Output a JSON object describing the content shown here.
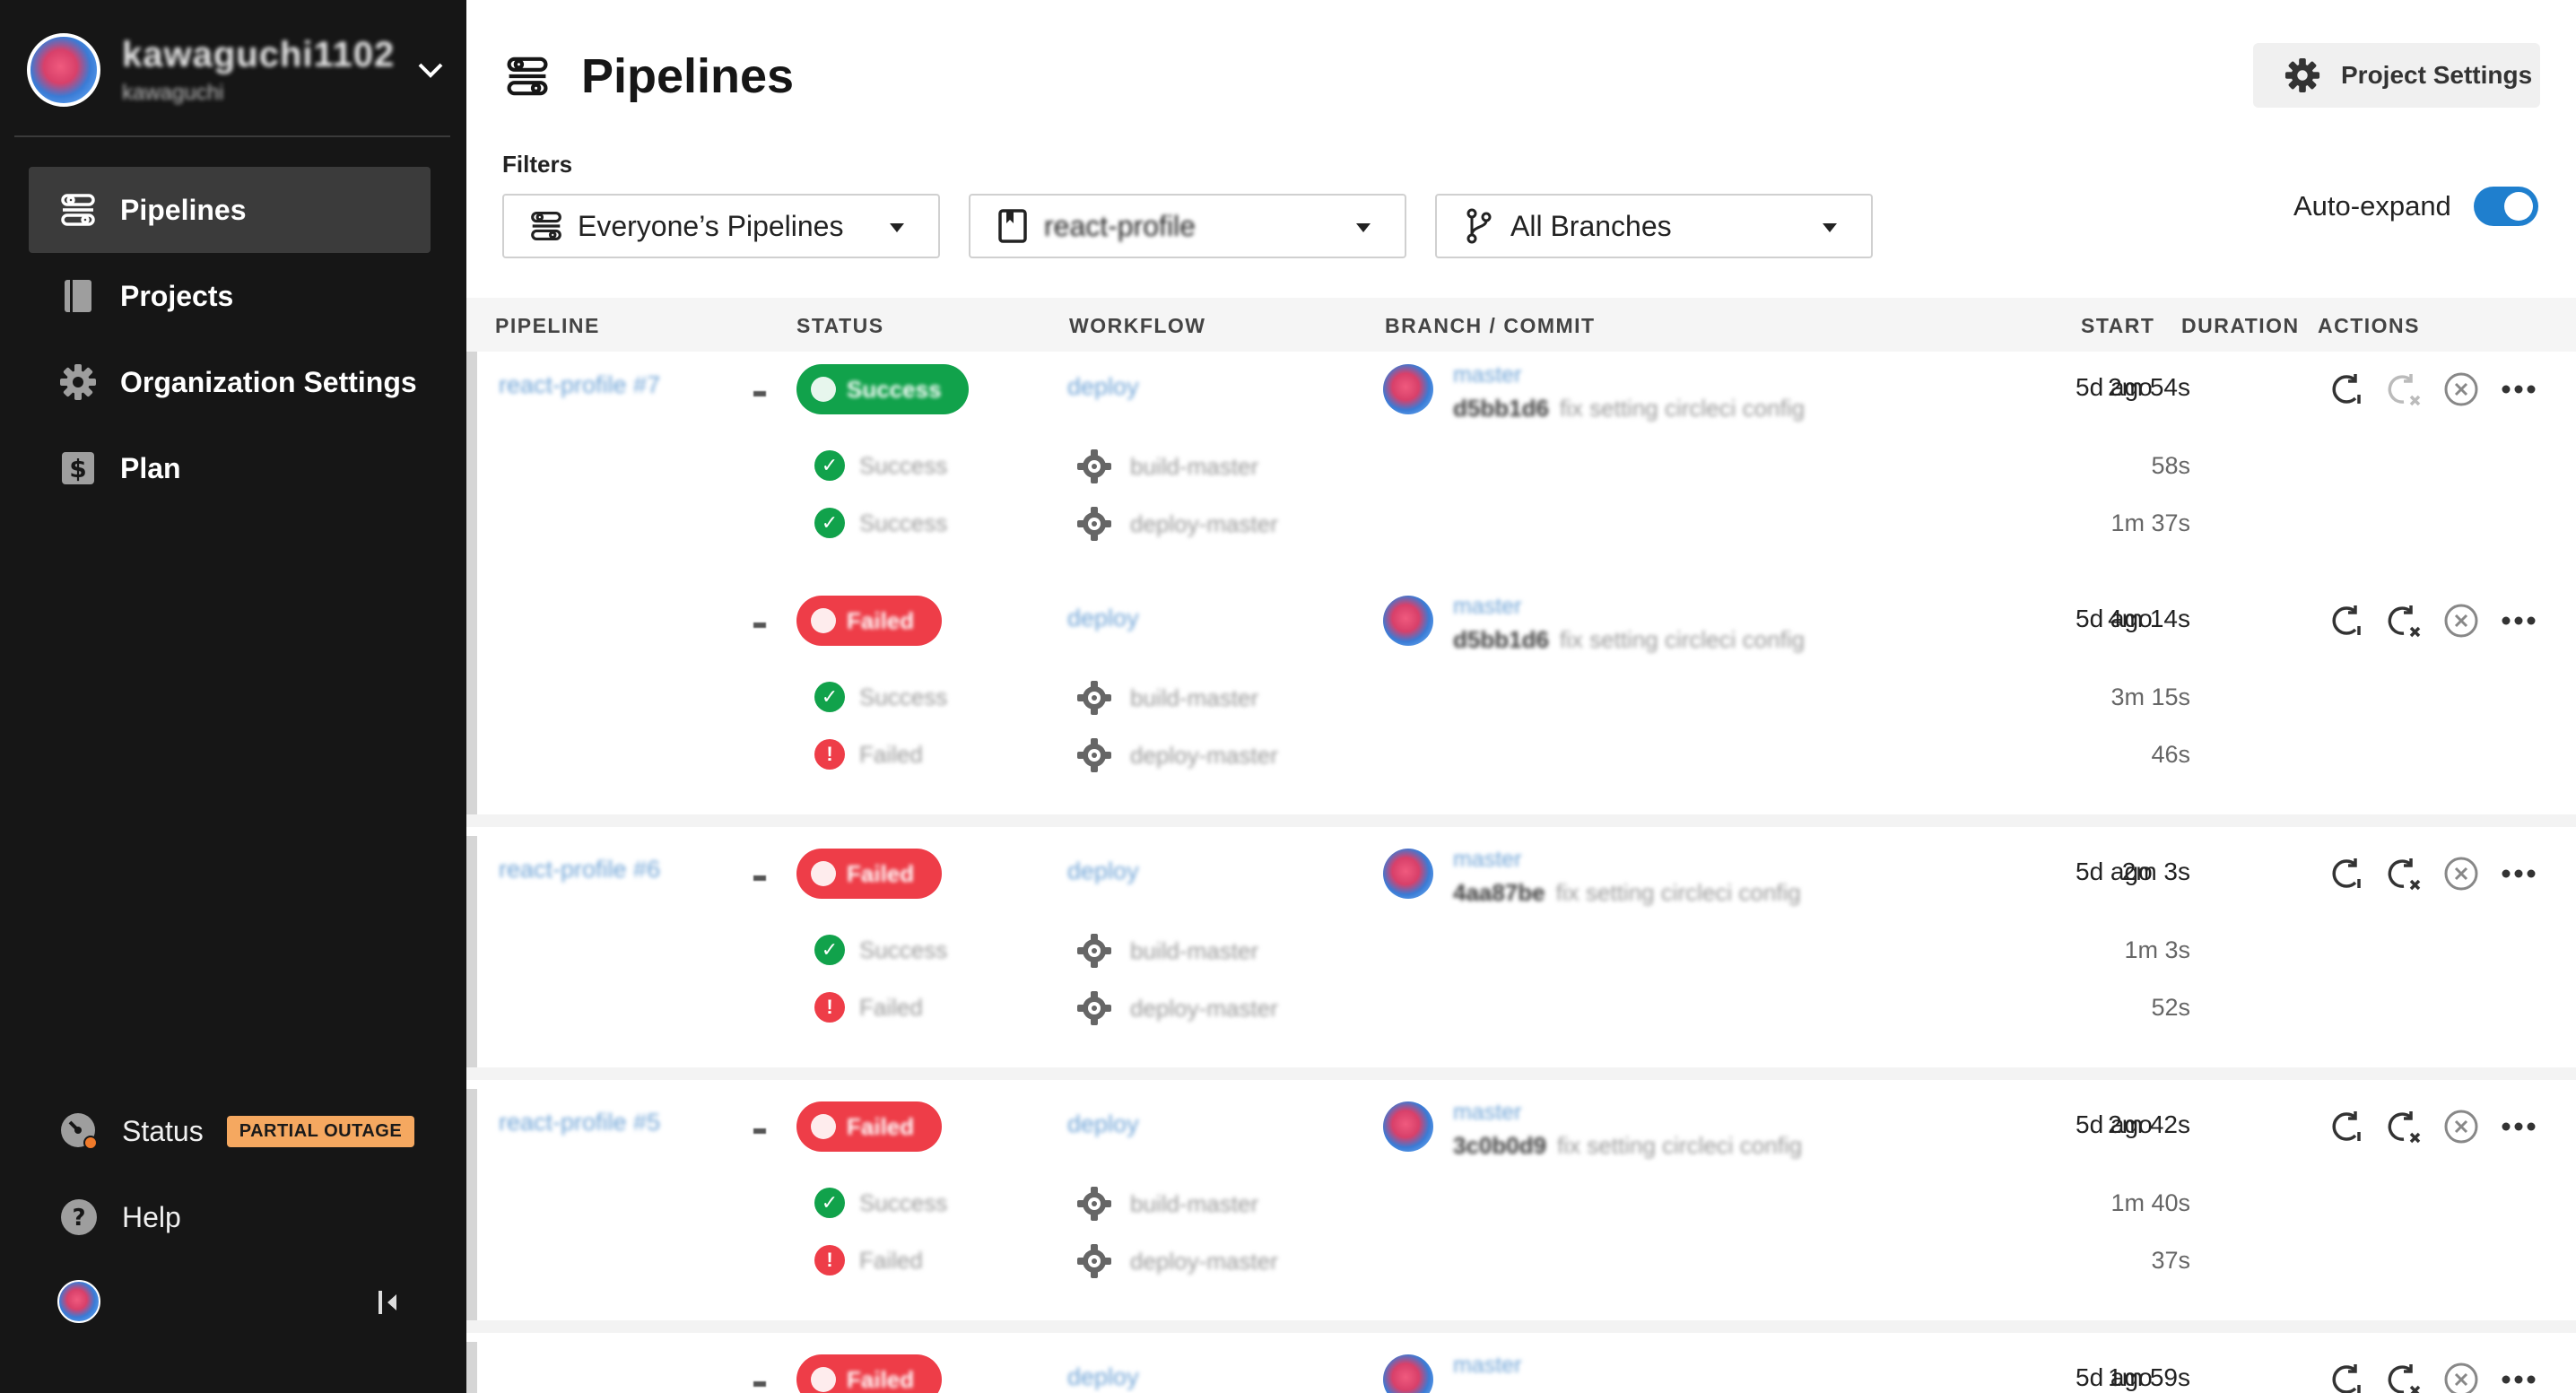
{
  "sidebar": {
    "user": {
      "name": "kawaguchi1102",
      "org": "kawaguchi"
    },
    "nav": [
      {
        "label": "Pipelines",
        "icon": "pipelines-icon",
        "active": true
      },
      {
        "label": "Projects",
        "icon": "book-icon",
        "active": false
      },
      {
        "label": "Organization Settings",
        "icon": "gear-icon",
        "active": false
      },
      {
        "label": "Plan",
        "icon": "dollar-icon",
        "active": false
      }
    ],
    "status": {
      "label": "Status",
      "badge": "PARTIAL OUTAGE"
    },
    "help": {
      "label": "Help"
    }
  },
  "header": {
    "title": "Pipelines",
    "project_settings_label": "Project Settings"
  },
  "filters": {
    "label": "Filters",
    "pipelines_value": "Everyone’s Pipelines",
    "project_value": "react-profile",
    "branches_value": "All Branches",
    "auto_expand_label": "Auto-expand",
    "auto_expand_on": true
  },
  "table": {
    "headers": {
      "pipeline": "PIPELINE",
      "status": "STATUS",
      "workflow": "WORKFLOW",
      "branch_commit": "BRANCH / COMMIT",
      "start": "START",
      "duration": "DURATION",
      "actions": "ACTIONS"
    },
    "groups": [
      {
        "pipeline": "react-profile #7",
        "workflows": [
          {
            "status": "Success",
            "status_type": "success",
            "workflow": "deploy",
            "branch": "master",
            "commit_hash": "d5bb1d6",
            "commit_msg": "fix setting circleci config",
            "start": "5d ago",
            "duration": "2m 54s",
            "jobs": [
              {
                "status": "Success",
                "status_type": "success",
                "name": "build-master",
                "duration": "58s"
              },
              {
                "status": "Success",
                "status_type": "success",
                "name": "deploy-master",
                "duration": "1m 37s"
              }
            ]
          },
          {
            "status": "Failed",
            "status_type": "failed",
            "workflow": "deploy",
            "branch": "master",
            "commit_hash": "d5bb1d6",
            "commit_msg": "fix setting circleci config",
            "start": "5d ago",
            "duration": "4m 14s",
            "jobs": [
              {
                "status": "Success",
                "status_type": "success",
                "name": "build-master",
                "duration": "3m 15s"
              },
              {
                "status": "Failed",
                "status_type": "failed",
                "name": "deploy-master",
                "duration": "46s"
              }
            ]
          }
        ]
      },
      {
        "pipeline": "react-profile #6",
        "workflows": [
          {
            "status": "Failed",
            "status_type": "failed",
            "workflow": "deploy",
            "branch": "master",
            "commit_hash": "4aa87be",
            "commit_msg": "fix setting circleci config",
            "start": "5d ago",
            "duration": "2m 3s",
            "jobs": [
              {
                "status": "Success",
                "status_type": "success",
                "name": "build-master",
                "duration": "1m 3s"
              },
              {
                "status": "Failed",
                "status_type": "failed",
                "name": "deploy-master",
                "duration": "52s"
              }
            ]
          }
        ]
      },
      {
        "pipeline": "react-profile #5",
        "workflows": [
          {
            "status": "Failed",
            "status_type": "failed",
            "workflow": "deploy",
            "branch": "master",
            "commit_hash": "3c0b0d9",
            "commit_msg": "fix setting circleci config",
            "start": "5d ago",
            "duration": "2m 42s",
            "jobs": [
              {
                "status": "Success",
                "status_type": "success",
                "name": "build-master",
                "duration": "1m 40s"
              },
              {
                "status": "Failed",
                "status_type": "failed",
                "name": "deploy-master",
                "duration": "37s"
              }
            ]
          }
        ]
      },
      {
        "pipeline": "",
        "workflows": [
          {
            "status": "Failed",
            "status_type": "failed",
            "workflow": "deploy",
            "branch": "master",
            "commit_hash": "",
            "commit_msg": "",
            "start": "5d ago",
            "duration": "1m 59s",
            "jobs": []
          }
        ]
      }
    ]
  },
  "colors": {
    "sidebar_bg": "#161616",
    "success": "#11a24b",
    "failed": "#ee3d48",
    "toggle": "#1f7fce",
    "outage_badge": "#f5a860"
  }
}
